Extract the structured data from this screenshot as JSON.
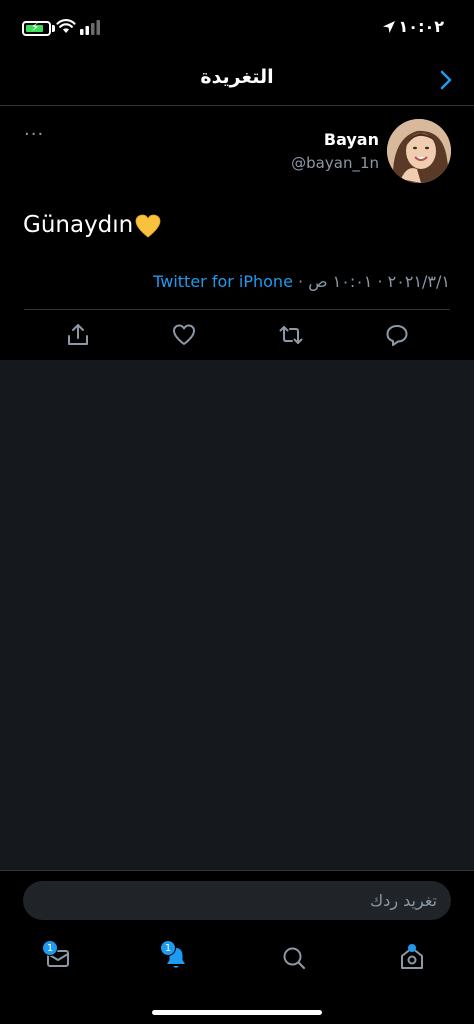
{
  "status_bar": {
    "time": "١٠:٠٢"
  },
  "nav": {
    "title": "التغريدة"
  },
  "tweet": {
    "user_name": "Bayan",
    "user_handle": "@bayan_1n",
    "more_label": "···",
    "text": "Günaydın",
    "emoji": "yellow-heart",
    "date_time": "٢٠٢١/٣/١ · ١٠:٠١ ص",
    "separator": " · ",
    "source": "Twitter for iPhone"
  },
  "composer": {
    "placeholder": "تغريد ردك"
  },
  "tabs": {
    "messages_badge": "1",
    "notifications_badge": "1"
  },
  "colors": {
    "accent": "#1d9bf0",
    "background": "#000000",
    "empty_area": "#15181c",
    "secondary_text": "#8b98a5"
  },
  "icons": [
    "battery-charging-icon",
    "wifi-icon",
    "signal-icon",
    "location-arrow-icon",
    "chevron-right-icon",
    "share-icon",
    "heart-icon",
    "retweet-icon",
    "reply-icon",
    "mail-icon",
    "bell-icon",
    "search-icon",
    "home-icon"
  ]
}
